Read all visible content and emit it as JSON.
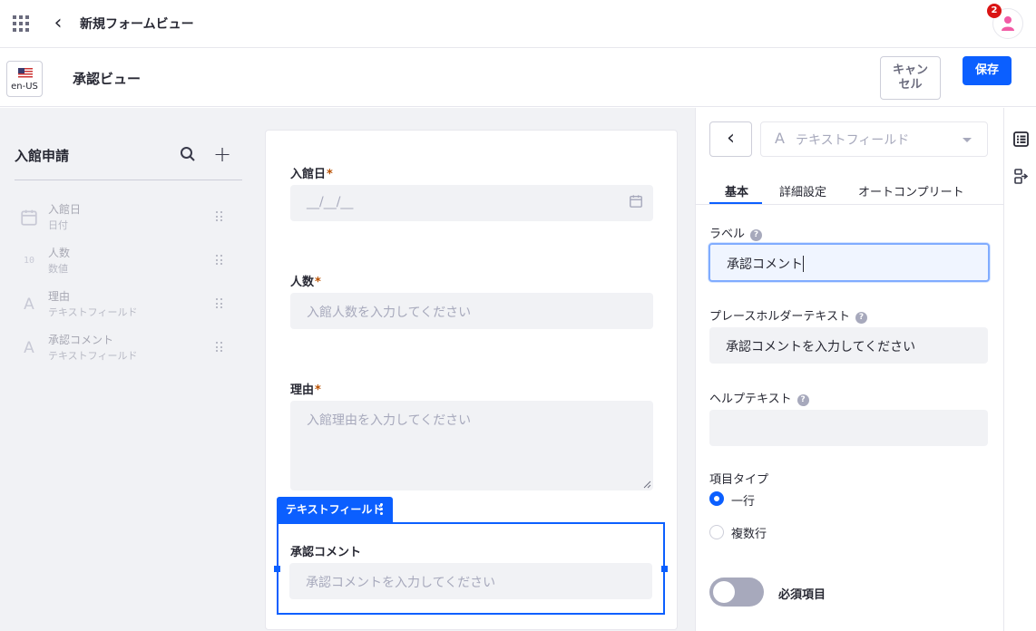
{
  "topbar": {
    "title": "新規フォームビュー",
    "notification_count": "2"
  },
  "subbar": {
    "locale": "en-US",
    "view_title": "承認ビュー",
    "cancel_label": "キャンセル",
    "cancel_line1": "キャン",
    "cancel_line2": "セル",
    "save_label": "保存"
  },
  "sidebar": {
    "title": "入館申請",
    "items": [
      {
        "name": "入館日",
        "type": "日付",
        "icon": "calendar-icon"
      },
      {
        "name": "人数",
        "type": "数値",
        "icon": "number-icon",
        "glyph": "10"
      },
      {
        "name": "理由",
        "type": "テキストフィールド",
        "icon": "text-field-icon",
        "glyph": "A"
      },
      {
        "name": "承認コメント",
        "type": "テキストフィールド",
        "icon": "text-field-icon",
        "glyph": "A"
      }
    ]
  },
  "form": {
    "fields": [
      {
        "label": "入館日",
        "required": "*",
        "placeholder": "__/__/__"
      },
      {
        "label": "人数",
        "required": "*",
        "placeholder": "入館人数を入力してください"
      },
      {
        "label": "理由",
        "required": "*",
        "placeholder": "入館理由を入力してください"
      },
      {
        "label": "承認コメント",
        "placeholder": "承認コメントを入力してください"
      }
    ],
    "selected_tag": "テキストフィールド"
  },
  "properties": {
    "field_type": "テキストフィールド",
    "field_type_glyph": "A",
    "tabs": [
      "基本",
      "詳細設定",
      "オートコンプリート"
    ],
    "active_tab": "基本",
    "label_caption": "ラベル",
    "label_value": "承認コメント",
    "placeholder_caption": "プレースホルダーテキスト",
    "placeholder_value": "承認コメントを入力してください",
    "help_caption": "ヘルプテキスト",
    "help_value": "",
    "item_type_caption": "項目タイプ",
    "item_type_options": [
      "一行",
      "複数行"
    ],
    "item_type_selected": "一行",
    "required_caption": "必須項目",
    "required_on": false,
    "help_mark": "?"
  },
  "colors": {
    "accent": "#0b5fff",
    "required_mark": "#b95000",
    "badge": "#da1414",
    "avatar": "#f15ba5"
  }
}
